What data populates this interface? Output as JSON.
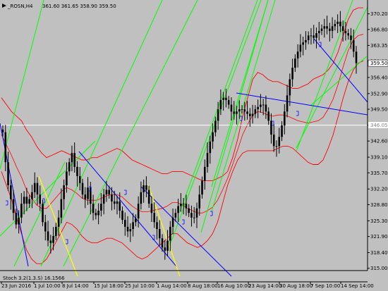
{
  "header": {
    "symbol": "_ROSN,H4",
    "ohlc": "361.60 361.65 358.90 359.50"
  },
  "indicator_label": "Stoch 3.2(1.3.S) 16.1566",
  "colors": {
    "background": "#c0c0c0",
    "candle": "#000000",
    "bollinger": "#ff0000",
    "uptrend": "#00ff00",
    "downtrend": "#0000ff",
    "yellow_line": "#ffff00",
    "level_line": "#ffffff",
    "price_box": "#ffffff"
  },
  "chart_data": {
    "type": "candlestick",
    "symbol": "_ROSN,H4",
    "ylim": [
      314.5,
      373.2
    ],
    "y_ticks": [
      "370.20",
      "366.80",
      "363.35",
      "359.90",
      "356.40",
      "352.90",
      "349.50",
      "346.05",
      "342.60",
      "339.10",
      "335.70",
      "332.20",
      "328.80",
      "325.30",
      "321.90",
      "318.40",
      "315.00"
    ],
    "x_ticks": [
      "23 Jun 2016",
      "1 Jul 10:00",
      "8 Jul 14:00",
      "15 Jul 18:00",
      "25 Jul 10:00",
      "1 Aug 14:00",
      "8 Aug 18:00",
      "16 Aug 10:00",
      "23 Aug 14:00",
      "30 Aug 18:00",
      "7 Sep 10:00",
      "14 Sep 14:00"
    ],
    "current_price": "359.50",
    "horizontal_level": "346.05",
    "close_series": [
      344.5,
      338,
      333,
      330,
      327,
      324.5,
      326,
      329,
      330.5,
      329,
      330,
      331.5,
      333.5,
      331,
      329,
      325,
      323,
      321,
      320.5,
      322,
      324,
      326,
      330,
      333,
      336,
      338,
      340,
      337,
      335,
      333.5,
      331,
      330,
      332.5,
      329,
      327,
      326.5,
      327.5,
      329,
      331,
      332,
      331,
      329.5,
      329,
      329.5,
      327.5,
      325.5,
      324,
      323,
      323.5,
      325,
      325.8,
      329,
      331.5,
      333,
      332,
      329,
      327,
      325,
      323.5,
      321.5,
      319.5,
      318.8,
      321,
      324,
      326,
      327,
      328.5,
      329,
      329,
      328,
      327,
      326,
      326,
      328,
      331,
      334,
      337,
      340,
      342.5,
      344.5,
      347,
      349.5,
      351.5,
      352,
      351.5,
      350.5,
      349,
      348.5,
      349,
      349.5,
      349.5,
      349,
      348.5,
      348,
      348.5,
      349.5,
      350,
      350.5,
      350.5,
      349,
      347,
      344,
      341.5,
      341.5,
      343.5,
      346,
      349,
      352.5,
      356,
      358.5,
      360.5,
      362,
      363.5,
      364,
      364.5,
      365.5,
      365.5,
      365,
      366,
      366.5,
      367,
      367.5,
      367,
      366.5,
      367.5,
      368,
      368.5,
      367.5,
      366.5,
      366,
      365.5,
      364.5,
      362,
      359.5
    ],
    "bollinger_upper": [
      352,
      350.5,
      349,
      348,
      347,
      345,
      343.5,
      341.5,
      340,
      339,
      339.5,
      340,
      340.5,
      340,
      339.5,
      339,
      338.5,
      338.5,
      339,
      339,
      339.5,
      340,
      340.5,
      341,
      340.5,
      339.5,
      338.5,
      338,
      337.5,
      337,
      336.5,
      336,
      335.5,
      335.5,
      336,
      336,
      336,
      335.5,
      335,
      334.5,
      334,
      334,
      334,
      334.5,
      335,
      336,
      339,
      343,
      348,
      352,
      356,
      357.5,
      357,
      356,
      355.5,
      355.5,
      355,
      354.5,
      354,
      354,
      354.5,
      355,
      356,
      356.5,
      357,
      358,
      359.5,
      362,
      365.5,
      369,
      371,
      371.5,
      371.5
    ],
    "bollinger_lower": [
      336,
      333,
      330,
      326,
      322.5,
      319,
      317,
      316,
      316,
      317,
      319,
      321,
      323,
      325,
      324.5,
      323.5,
      322,
      321,
      320.5,
      320.5,
      321,
      321.5,
      321.5,
      321,
      320.5,
      319.5,
      318.5,
      317.5,
      317,
      317.5,
      318.5,
      319.5,
      320.5,
      321.5,
      322.5,
      322.5,
      321.5,
      320.5,
      320,
      319.5,
      320,
      321,
      322.5,
      325,
      329,
      333,
      336,
      338.5,
      340,
      340.5,
      340.5,
      340.5,
      340.5,
      340.5,
      340.5,
      341,
      341.5,
      341.5,
      341,
      340,
      339,
      338,
      337.5,
      337.5,
      338.5,
      341,
      344,
      348,
      352,
      355.5,
      358,
      359.5,
      360
    ]
  }
}
